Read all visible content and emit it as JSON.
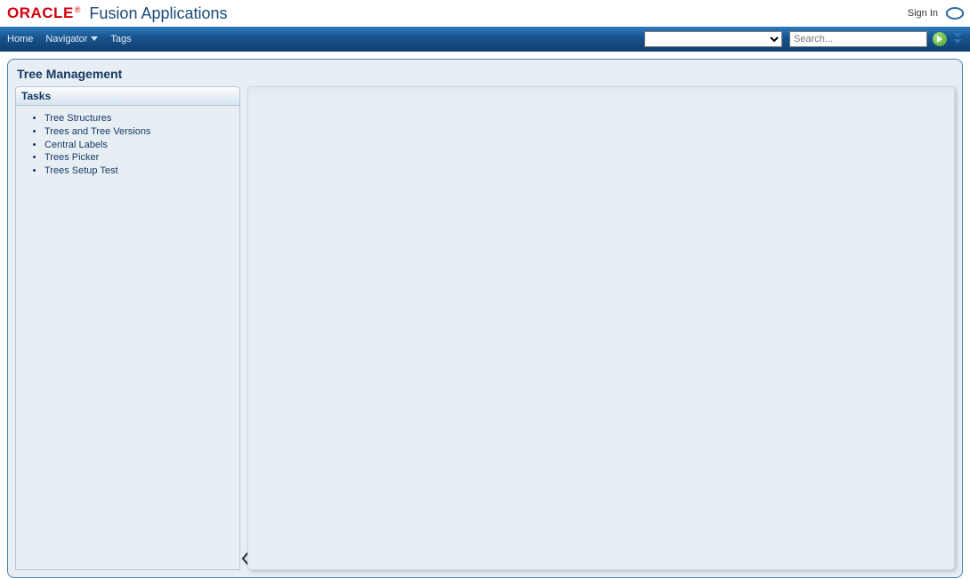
{
  "banner": {
    "logo_mark": "ORACLE",
    "logo_reg": "®",
    "app_title": "Fusion Applications",
    "sign_in": "Sign In"
  },
  "nav": {
    "home": "Home",
    "navigator": "Navigator",
    "tags": "Tags",
    "select_value": "",
    "search_placeholder": "Search..."
  },
  "page": {
    "title": "Tree Management"
  },
  "sidebar": {
    "header": "Tasks",
    "items": [
      {
        "label": "Tree Structures"
      },
      {
        "label": "Trees and Tree Versions"
      },
      {
        "label": "Central Labels"
      },
      {
        "label": "Trees Picker"
      },
      {
        "label": "Trees Setup Test"
      }
    ]
  }
}
